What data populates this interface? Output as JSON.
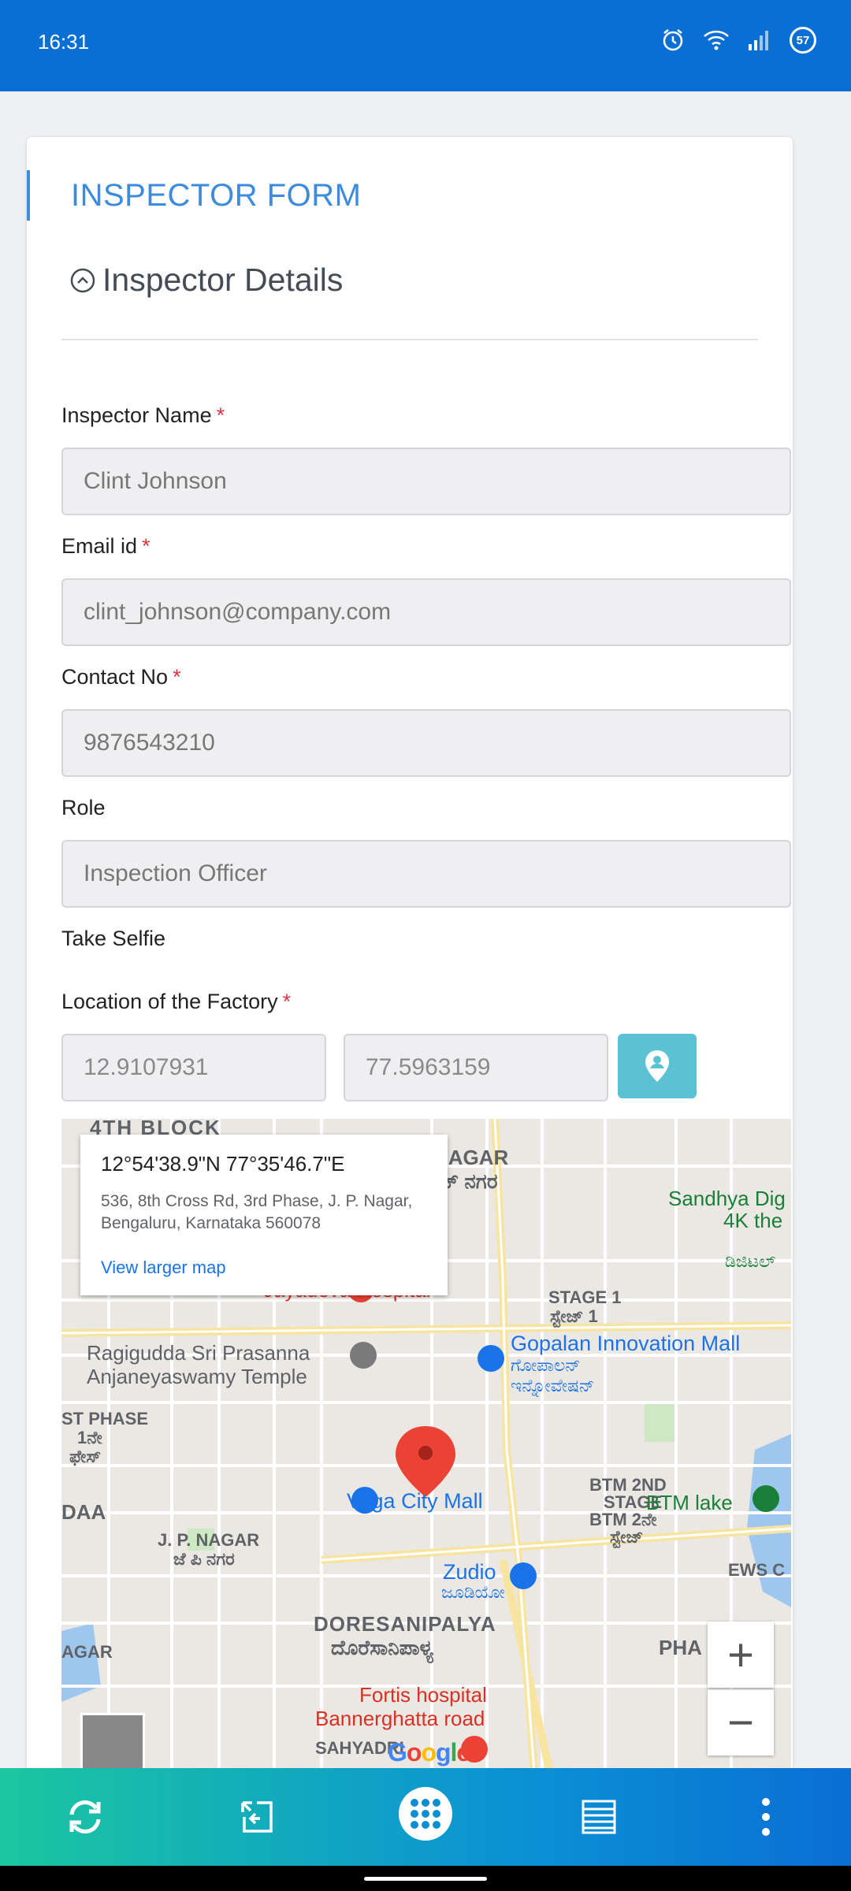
{
  "status_bar": {
    "time": "16:31",
    "battery": "57"
  },
  "form": {
    "title": "INSPECTOR FORM",
    "section_title": "Inspector Details",
    "fields": [
      {
        "label": "Inspector Name",
        "value": "Clint Johnson",
        "required": "*"
      },
      {
        "label": "Email id",
        "value": "clint_johnson@company.com",
        "required": "*"
      },
      {
        "label": "Contact No",
        "value": "9876543210",
        "required": "*"
      },
      {
        "label": "Role",
        "value": "Inspection Officer"
      }
    ],
    "selfie_label": "Take Selfie",
    "location": {
      "label": "Location of the Factory",
      "required": "*",
      "latitude": "12.9107931",
      "longitude": "77.5963159"
    }
  },
  "map": {
    "info_window": {
      "coords": "12°54'38.9\"N 77°35'46.7\"E",
      "address": "536, 8th Cross Rd, 3rd Phase, J. P. Nagar, Bengaluru, Karnataka 560078",
      "link": "View larger map"
    },
    "labels": {
      "block4": "4TH BLOCK",
      "k_nagar": "K NAGAR",
      "k_nagar_kn": "ಕ್ ನಗರ",
      "sandhya": "Sandhya Dig",
      "sandhya2": "4K the",
      "sandhya_kn": "ಡಿಜಿಟಲ್",
      "hospital": "Jayadeva Hospital",
      "stage1": "STAGE 1",
      "stage1_kn": "ಸ್ಟೇಜ್ 1",
      "ragigudda1": "Ragigudda Sri Prasanna",
      "ragigudda2": "Anjaneyaswamy Temple",
      "gopalan": "Gopalan Innovation Mall",
      "gopalan_kn1": "ಗೋಪಾಲನ್",
      "gopalan_kn2": "ಇನ್ನೋವೇಷನ್",
      "phase1": "ST PHASE",
      "phase1_kn": "1ನೇ",
      "phase1_kn2": "ಫೇಸ್",
      "vega": "Vega City Mall",
      "btm2": "BTM 2ND",
      "btm2b": "STAGE",
      "btm2_kn": "BTM 2ನೇ",
      "btm2_kn2": "ಸ್ಟೇಜ್",
      "btm_lake": "BTM lake",
      "daa": "DAA",
      "jp_nagar": "J. P. NAGAR",
      "jp_nagar_kn": "ಜೆ ಪಿ ನಗರ",
      "zudio": "Zudio",
      "zudio_kn": "ಜೂಡಿಯೋ",
      "ews": "EWS C",
      "doresani": "DORESANIPALYA",
      "doresani_kn": "ದೊರೆಸಾನಿಪಾಳ್ಯ",
      "pha": "PHA",
      "fortis1": "Fortis hospital",
      "fortis2": "Bannerghatta road",
      "sahyadri": "SAHYADRI",
      "agar": "AGAR",
      "google": "Google"
    },
    "zoom_in": "+",
    "zoom_out": "−"
  },
  "colors": {
    "accent": "#3d8bdc",
    "status_bar": "#0a6fd4",
    "location_button": "#5bc2d3",
    "required": "#d9363e"
  }
}
